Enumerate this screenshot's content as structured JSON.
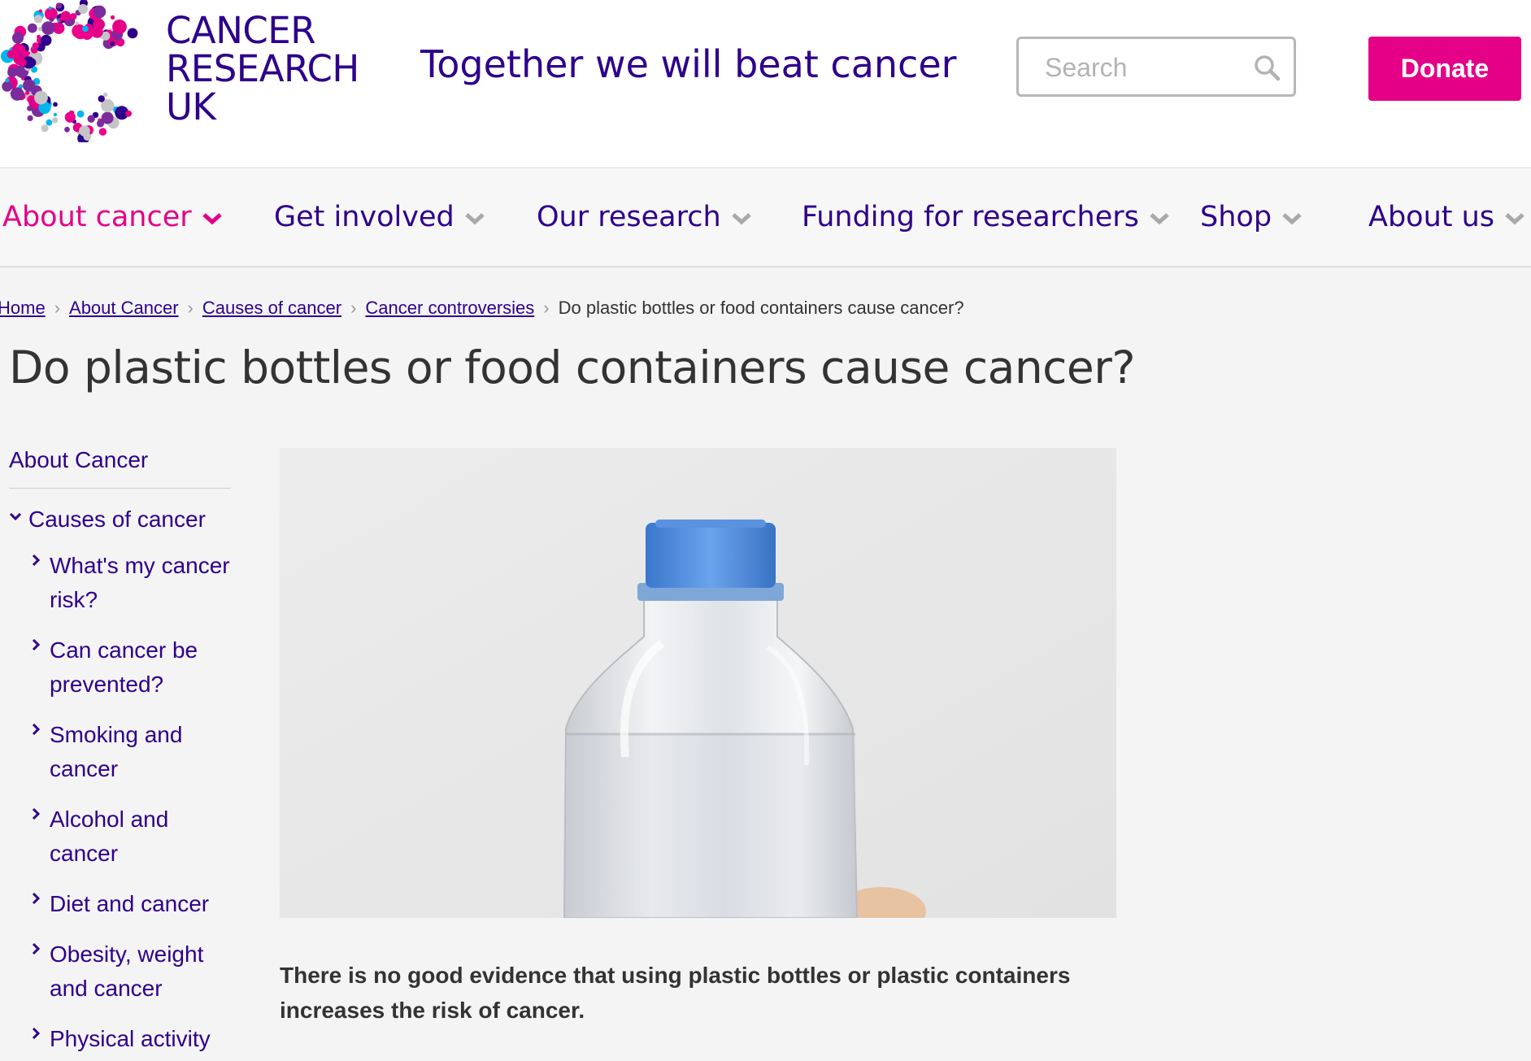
{
  "header": {
    "logo": {
      "line1": "CANCER",
      "line2": "RESEARCH",
      "line3": "UK"
    },
    "tagline": "Together we will beat cancer",
    "search_placeholder": "Search",
    "donate_label": "Donate"
  },
  "nav": {
    "items": [
      {
        "label": "About cancer"
      },
      {
        "label": "Get involved"
      },
      {
        "label": "Our research"
      },
      {
        "label": "Funding for researchers"
      },
      {
        "label": "Shop"
      },
      {
        "label": "About us"
      }
    ]
  },
  "breadcrumb": {
    "items": [
      "Home",
      "About Cancer",
      "Causes of cancer",
      "Cancer controversies"
    ],
    "current": "Do plastic bottles or food containers cause cancer?"
  },
  "page": {
    "title": "Do plastic bottles or food containers cause cancer?",
    "lead": "There is no good evidence that using plastic bottles or plastic containers increases the risk of cancer."
  },
  "sidenav": {
    "top": "About Cancer",
    "section": "Causes of cancer",
    "items": [
      {
        "label": "What's my cancer risk?"
      },
      {
        "label": "Can cancer be prevented?"
      },
      {
        "label": "Smoking and cancer"
      },
      {
        "label": "Alcohol and cancer"
      },
      {
        "label": "Diet and cancer"
      },
      {
        "label": "Obesity, weight and cancer"
      },
      {
        "label": "Physical activity"
      }
    ]
  },
  "colors": {
    "brand_purple": "#2e008b",
    "brand_pink": "#e40087"
  }
}
